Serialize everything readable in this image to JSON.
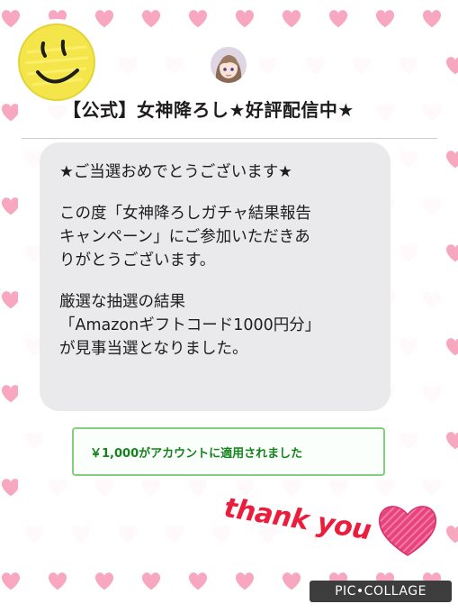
{
  "header": {
    "title": "【公式】女神降ろし★好評配信中★"
  },
  "message": {
    "headline": "★ご当選おめでとうございます★",
    "para1_line1": "この度「女神降ろしガチャ結果報告",
    "para1_line2": "キャンペーン」にご参加いただきあ",
    "para1_line3": "りがとうございます。",
    "para2_line1": "厳選な抽選の結果",
    "para2_line2": "「Amazonギフトコード1000円分」",
    "para2_line3": "が見事当選となりました。"
  },
  "notice": {
    "text": "￥1,000がアカウントに適用されました"
  },
  "decor": {
    "thanks_text": "thank you",
    "watermark": "PIC•COLLAGE",
    "smiley_icon": "smiley-face-icon",
    "heart_icon": "heart-icon"
  },
  "colors": {
    "heart_bg": "#f7a8c0",
    "bubble": "#eaeaec",
    "notice_border": "#82cf82",
    "notice_text": "#16821e",
    "thanks": "#ec1c3c",
    "big_heart": "#e8447c",
    "smiley": "#f4e64a"
  }
}
